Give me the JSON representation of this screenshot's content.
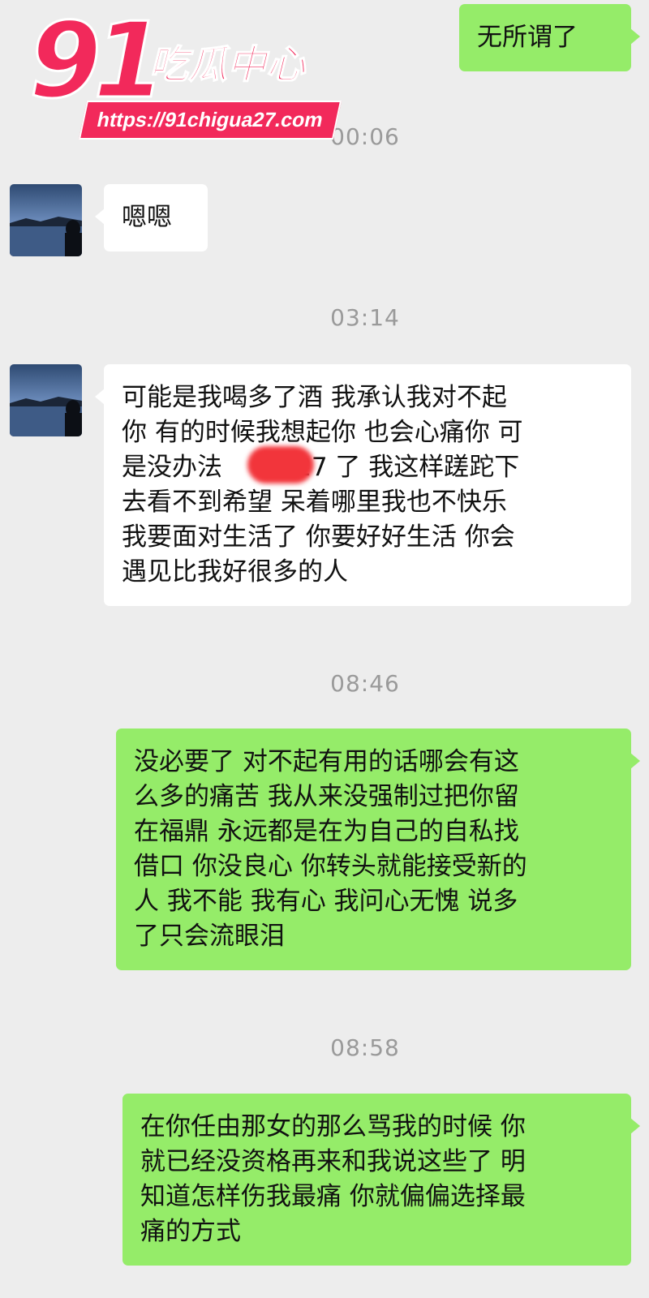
{
  "colors": {
    "background": "#ededed",
    "incoming_bubble": "#ffffff",
    "outgoing_bubble": "#95ec69",
    "timestamp": "#9a9a9a",
    "watermark": "#f2295b",
    "redaction": "#f2353b"
  },
  "watermark": {
    "number": "91",
    "title": "吃瓜中心",
    "url": "https://91chigua27.com"
  },
  "messages": [
    {
      "side": "out",
      "text": "无所谓了"
    },
    {
      "type": "time",
      "text": "00:06"
    },
    {
      "side": "in",
      "avatar": "landscape-avatar-icon",
      "text": "嗯嗯"
    },
    {
      "type": "time",
      "text": "03:14"
    },
    {
      "side": "in",
      "avatar": "landscape-avatar-icon",
      "text": "可能是我喝多了酒 我承认我对不起\n你 有的时候我想起你 也会心痛你 可\n是没办法     我 27 了 我这样蹉跎下\n去看不到希望 呆着哪里我也不快乐\n我要面对生活了 你要好好生活 你会\n遇见比我好很多的人"
    },
    {
      "type": "time",
      "text": "08:46"
    },
    {
      "side": "out",
      "text": "没必要了 对不起有用的话哪会有这\n么多的痛苦 我从来没强制过把你留\n在福鼎 永远都是在为自己的自私找\n借口 你没良心 你转头就能接受新的\n人 我不能 我有心 我问心无愧 说多\n了只会流眼泪"
    },
    {
      "type": "time",
      "text": "08:58"
    },
    {
      "side": "out",
      "text": "在你任由那女的那么骂我的时候 你\n就已经没资格再来和我说这些了 明\n知道怎样伤我最痛 你就偏偏选择最\n痛的方式"
    }
  ]
}
